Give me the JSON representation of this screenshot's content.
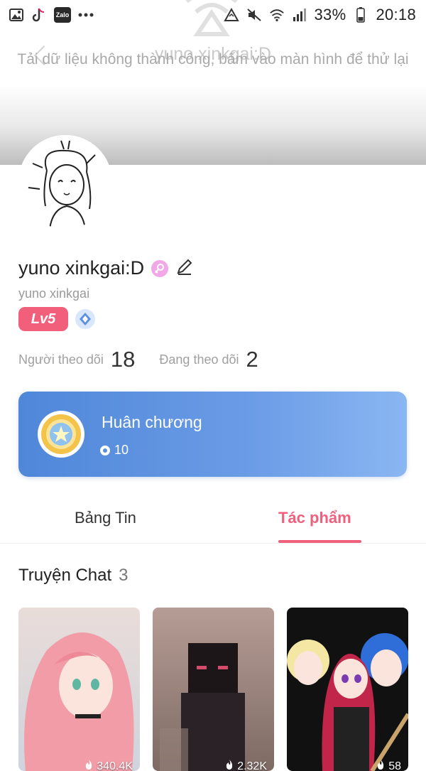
{
  "status_bar": {
    "battery": "33%",
    "time": "20:18",
    "left_icons": [
      "gallery-icon",
      "tiktok-icon",
      "zalo-icon",
      "more-dots-icon"
    ],
    "zalo_label": "Zalo",
    "right_icons": [
      "network-icon",
      "mute-icon",
      "wifi-icon",
      "signal-icon",
      "battery-icon"
    ]
  },
  "header": {
    "title": "yuno xinkgai:D",
    "error_message": "Tải dữ liệu không thành công, bấm vào màn hình để thử lại"
  },
  "profile": {
    "display_name": "yuno xinkgai:D",
    "username": "yuno xinkgai",
    "level": "Lv5",
    "followers_label": "Người theo dõi",
    "followers_count": "18",
    "following_label": "Đang theo dõi",
    "following_count": "2"
  },
  "medal": {
    "title": "Huân chương",
    "count": "10"
  },
  "tabs": [
    {
      "label": "Bảng Tin",
      "active": false
    },
    {
      "label": "Tác phẩm",
      "active": true
    }
  ],
  "section": {
    "title": "Truyện Chat",
    "count": "3"
  },
  "stories": [
    {
      "views": "340.4K"
    },
    {
      "views": "2.32K"
    },
    {
      "views": "58"
    }
  ],
  "colors": {
    "accent": "#f0607d",
    "medal_card": "#5b8fe0",
    "level_badge": "#f25f7b"
  }
}
